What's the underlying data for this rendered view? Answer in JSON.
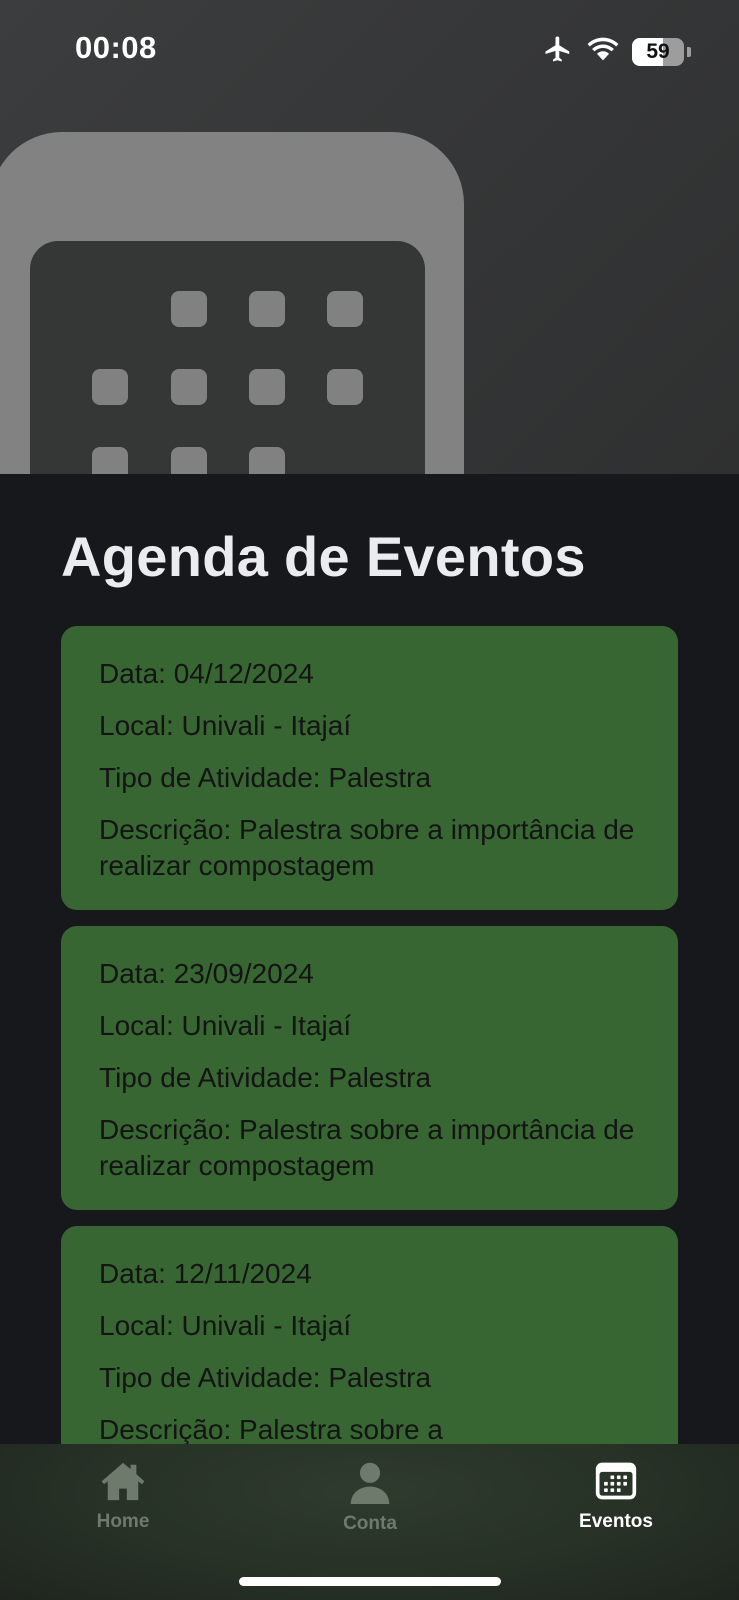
{
  "status_bar": {
    "time": "00:08",
    "battery_level": "59",
    "battery_fraction": 0.59,
    "icons": [
      "airplane-icon",
      "wifi-icon",
      "battery-icon"
    ]
  },
  "header_image": {
    "icon": "calendar-icon",
    "colors": {
      "background": "#3a3b3c",
      "foreground": "#828282"
    }
  },
  "page": {
    "title": "Agenda de Eventos"
  },
  "events": [
    {
      "date": "Data: 04/12/2024",
      "location": "Local: Univali - Itajaí",
      "activity": "Tipo de Atividade: Palestra",
      "description": "Descrição: Palestra sobre a importância de realizar compostagem"
    },
    {
      "date": "Data: 23/09/2024",
      "location": "Local: Univali - Itajaí",
      "activity": "Tipo de Atividade: Palestra",
      "description": "Descrição: Palestra sobre a importância de realizar compostagem"
    },
    {
      "date": "Data: 12/11/2024",
      "location": "Local: Univali - Itajaí",
      "activity": "Tipo de Atividade: Palestra",
      "description": "Descrição: Palestra sobre a"
    }
  ],
  "tab_bar": {
    "tabs": [
      {
        "label": "Home",
        "icon": "house-icon",
        "active": false
      },
      {
        "label": "Conta",
        "icon": "person-icon",
        "active": false
      },
      {
        "label": "Eventos",
        "icon": "calendar-icon",
        "active": true
      }
    ]
  },
  "colors": {
    "card": "#376632",
    "background": "#17181b",
    "title": "#ececee",
    "tab_inactive": "#6d7a6c",
    "tab_active": "#ffffff"
  }
}
